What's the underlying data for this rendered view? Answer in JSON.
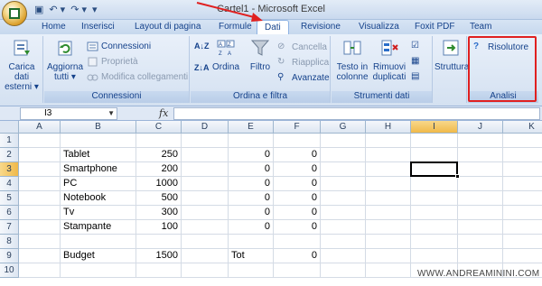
{
  "window": {
    "title": "Cartel1 - Microsoft Excel"
  },
  "qat": {
    "save": "▣",
    "undo": "↶ ▾",
    "redo": "↷ ▾",
    "more": "▾"
  },
  "tabs": [
    {
      "label": "Home"
    },
    {
      "label": "Inserisci"
    },
    {
      "label": "Layout di pagina"
    },
    {
      "label": "Formule"
    },
    {
      "label": "Dati"
    },
    {
      "label": "Revisione"
    },
    {
      "label": "Visualizza"
    },
    {
      "label": "Foxit PDF"
    },
    {
      "label": "Team"
    }
  ],
  "ribbon": {
    "carica": {
      "line1": "Carica dati",
      "line2": "esterni ▾"
    },
    "aggiorna": {
      "line1": "Aggiorna",
      "line2": "tutti ▾"
    },
    "connessioni_btn": "Connessioni",
    "proprieta": "Proprietà",
    "modifica": "Modifica collegamenti",
    "connessioni_group": "Connessioni",
    "ordina": "Ordina",
    "filtro": "Filtro",
    "cancella": "Cancella",
    "riapplica": "Riapplica",
    "avanzate": "Avanzate",
    "ordina_group": "Ordina e filtra",
    "testo": {
      "line1": "Testo in",
      "line2": "colonne"
    },
    "rimuovi": {
      "line1": "Rimuovi",
      "line2": "duplicati"
    },
    "strumenti_group": "Strumenti dati",
    "struttura": "Struttura",
    "risolutore": "Risolutore",
    "analisi_group": "Analisi"
  },
  "formula_bar": {
    "name_box": "I3",
    "fx": "fx",
    "value": ""
  },
  "columns": [
    "A",
    "B",
    "C",
    "D",
    "E",
    "F",
    "G",
    "H",
    "I",
    "J",
    "K"
  ],
  "active_column": "I",
  "rows": [
    "1",
    "2",
    "3",
    "4",
    "5",
    "6",
    "7",
    "8",
    "9",
    "10"
  ],
  "active_row": "3",
  "cells": {
    "B2": "Tablet",
    "C2": "250",
    "E2": "0",
    "F2": "0",
    "B3": "Smartphone",
    "C3": "200",
    "E3": "0",
    "F3": "0",
    "B4": "PC",
    "C4": "1000",
    "E4": "0",
    "F4": "0",
    "B5": "Notebook",
    "C5": "500",
    "E5": "0",
    "F5": "0",
    "B6": "Tv",
    "C6": "300",
    "E6": "0",
    "F6": "0",
    "B7": "Stampante",
    "C7": "100",
    "E7": "0",
    "F7": "0",
    "B9": "Budget",
    "C9": "1500",
    "E9": "Tot",
    "F9": "0"
  },
  "numeric_columns": [
    "C",
    "F"
  ],
  "watermark": "WWW.ANDREAMININI.COM",
  "colors": {
    "annotation": "#e02020",
    "ribbon": "#dbe6f4",
    "active_header": "#f0b94a"
  }
}
